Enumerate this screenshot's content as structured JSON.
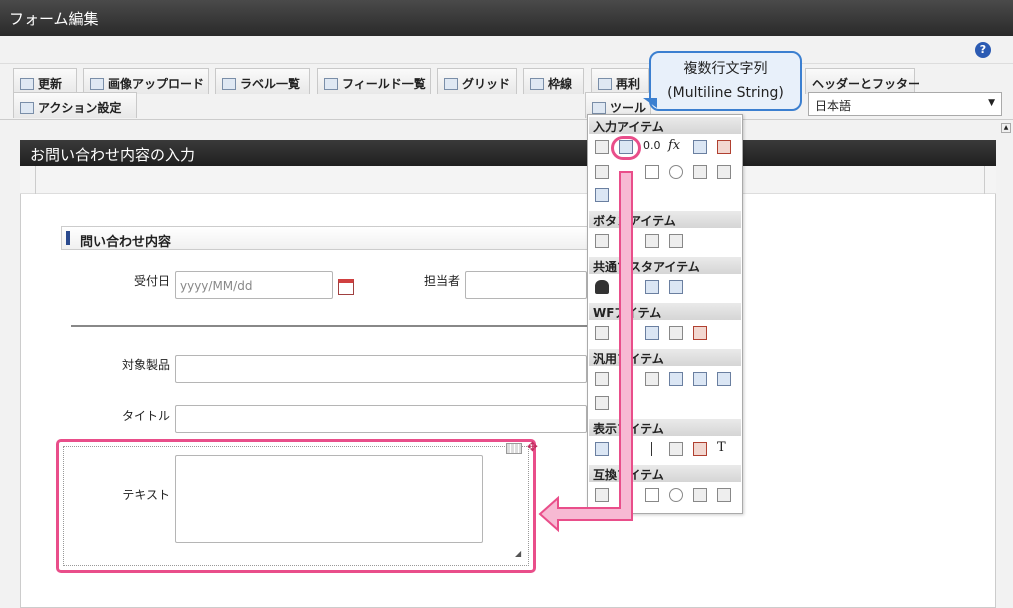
{
  "window": {
    "title": "フォーム編集"
  },
  "toolbar": {
    "tabs": [
      {
        "label": "更新"
      },
      {
        "label": "画像アップロード"
      },
      {
        "label": "ラベル一覧"
      },
      {
        "label": "フィールド一覧"
      },
      {
        "label": "グリッド"
      },
      {
        "label": "枠線"
      },
      {
        "label": "再利"
      },
      {
        "label": "ヘッダーとフッター"
      }
    ],
    "action_label": "アクション設定",
    "tool_label": "ツール",
    "language": "日本語"
  },
  "form": {
    "title": "お問い合わせ内容の入力",
    "section_title": "問い合わせ内容",
    "fields": {
      "received_date_label": "受付日",
      "received_date_placeholder": "yyyy/MM/dd",
      "assignee_label": "担当者",
      "product_label": "対象製品",
      "title_label": "タイトル",
      "text_label": "テキスト"
    }
  },
  "palette": {
    "sections": [
      {
        "label": "入力アイテム"
      },
      {
        "label": "ボタンアイテム"
      },
      {
        "label": "共通マスタアイテム"
      },
      {
        "label": "WFアイテム"
      },
      {
        "label": "汎用アイテム"
      },
      {
        "label": "表示アイテム"
      },
      {
        "label": "互換アイテム"
      }
    ],
    "fx_symbol": "fx",
    "t_symbol": "T",
    "numbers_symbol": "0.0"
  },
  "tooltip": {
    "line1": "複数行文字列",
    "line2": "(Multiline String)"
  },
  "colors": {
    "accent_pink": "#e94e8a",
    "tooltip_border": "#3b7fd0",
    "header_dark": "#2a2a2a"
  }
}
